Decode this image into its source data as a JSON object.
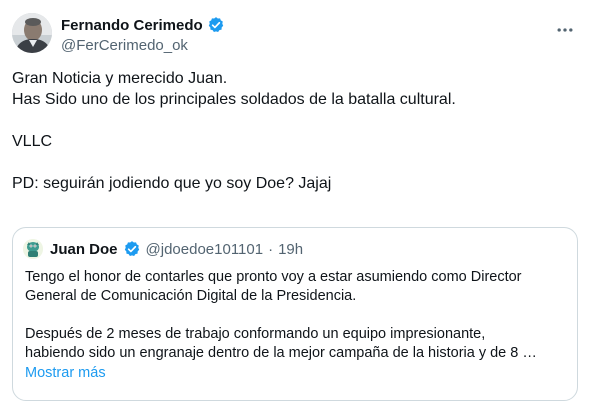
{
  "author": {
    "display_name": "Fernando Cerimedo",
    "handle": "@FerCerimedo_ok",
    "avatar_icon": "profile-photo",
    "verified_icon": "verified-badge-icon"
  },
  "tweet": {
    "lines": [
      "Gran Noticia y merecido Juan.",
      "Has Sido uno de los principales soldados de la batalla cultural.",
      "VLLC",
      "PD: seguirán jodiendo que yo soy Doe? Jajaj"
    ]
  },
  "quoted": {
    "display_name": "Juan Doe",
    "handle": "@jdoedoe101101",
    "separator": "·",
    "time": "19h",
    "text_lines": [
      "Tengo el honor de contarles que pronto voy a estar asumiendo como Director",
      "General de Comunicación Digital de la Presidencia.",
      "Después de 2 meses de trabajo conformando un equipo impresionante,",
      "habiendo sido un engranaje dentro de la mejor campaña de la historia y de 8 …"
    ],
    "show_more_label": "Mostrar más"
  },
  "colors": {
    "text": "#0f1419",
    "secondary": "#536471",
    "link": "#1d9bf0",
    "verified": "#1d9bf0",
    "border": "#cfd9de"
  }
}
